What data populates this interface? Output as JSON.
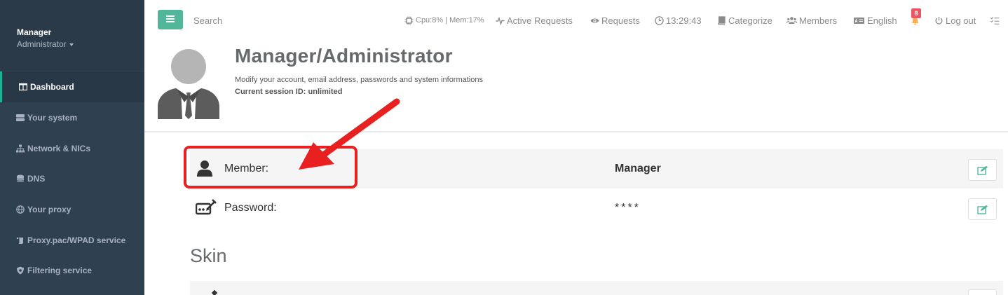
{
  "sidebar": {
    "profile": {
      "name": "Manager",
      "role": "Administrator"
    },
    "items": [
      {
        "label": "Dashboard",
        "icon": "book-open-icon",
        "active": true
      },
      {
        "label": "Your system",
        "icon": "server-icon",
        "active": false
      },
      {
        "label": "Network & NICs",
        "icon": "sitemap-icon",
        "active": false
      },
      {
        "label": "DNS",
        "icon": "database-icon",
        "active": false
      },
      {
        "label": "Your proxy",
        "icon": "globe-icon",
        "active": false
      },
      {
        "label": "Proxy.pac/WPAD service",
        "icon": "scroll-icon",
        "active": false
      },
      {
        "label": "Filtering service",
        "icon": "shield-icon",
        "active": false
      }
    ]
  },
  "topbar": {
    "search_placeholder": "Search",
    "cpu_mem": "Cpu:8% | Mem:17%",
    "active_requests": "Active Requests",
    "requests": "Requests",
    "clock": "13:29:43",
    "categorize": "Categorize",
    "members": "Members",
    "language": "English",
    "notifications_count": "8",
    "logout": "Log out"
  },
  "header": {
    "title": "Manager/Administrator",
    "subtitle": "Modify your account, email address, passwords and system informations",
    "session": "Current session ID: unlimited"
  },
  "rows": [
    {
      "label": "Member:",
      "value": "Manager",
      "icon": "user-icon"
    },
    {
      "label": "Password:",
      "value": "****",
      "icon": "signature-icon"
    }
  ],
  "skin": {
    "title": "Skin"
  },
  "colors": {
    "accent": "#52b69a",
    "sidebar": "#2f4050",
    "annotation": "#e8201f",
    "badge": "#ed5565"
  }
}
